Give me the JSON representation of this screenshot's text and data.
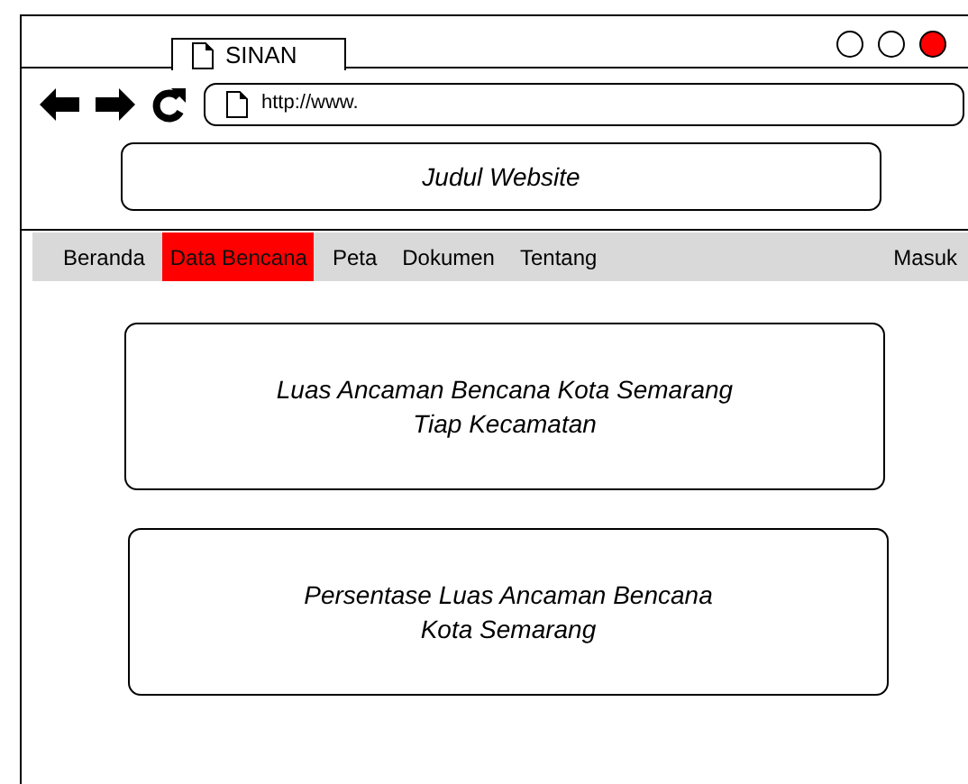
{
  "tab": {
    "title": "SINAN"
  },
  "window_controls": [
    {
      "color": "#ffffff"
    },
    {
      "color": "#ffffff"
    },
    {
      "color": "#ff0000"
    }
  ],
  "address_bar": {
    "value": "http://www."
  },
  "header": {
    "title": "Judul Website"
  },
  "menu": {
    "items": [
      {
        "label": "Beranda",
        "selected": false
      },
      {
        "label": "Data Bencana",
        "selected": true
      },
      {
        "label": "Peta",
        "selected": false
      },
      {
        "label": "Dokumen",
        "selected": false
      },
      {
        "label": "Tentang",
        "selected": false
      }
    ],
    "login": "Masuk"
  },
  "cards": [
    {
      "text": "Luas Ancaman Bencana Kota Semarang\nTiap Kecamatan"
    },
    {
      "text": "Persentase Luas Ancaman Bencana\nKota Semarang"
    }
  ]
}
